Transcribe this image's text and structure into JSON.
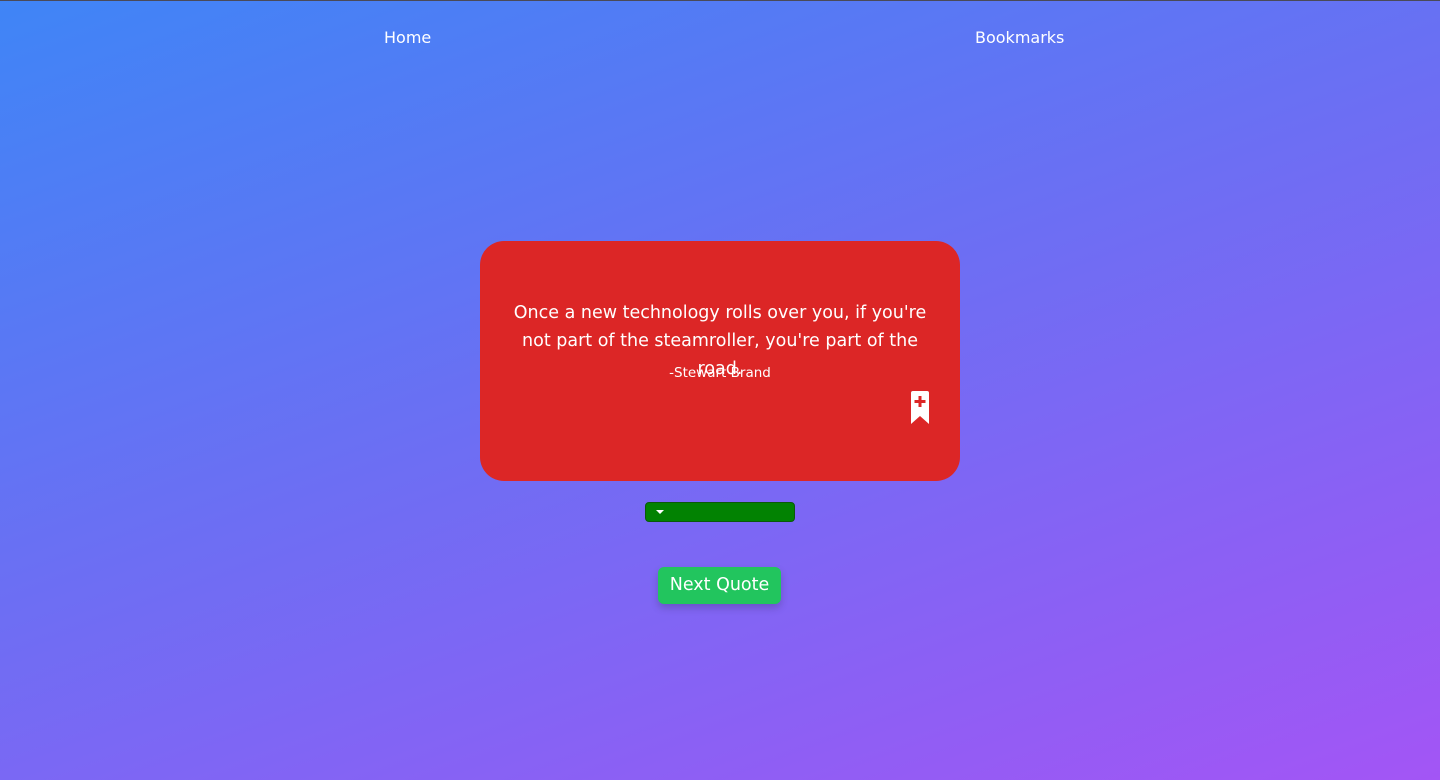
{
  "nav": {
    "home_label": "Home",
    "bookmarks_label": "Bookmarks"
  },
  "quote": {
    "text": "Once a new technology rolls over you, if you're not part of the steamroller, you're part of the road.",
    "author": "-Stewart Brand"
  },
  "bookmark_button": {
    "icon": "bookmark-plus-icon"
  },
  "category_select": {
    "selected": "",
    "icon": "chevron-down-icon"
  },
  "next_button": {
    "label": "Next Quote"
  },
  "colors": {
    "background_start": "#3f85f6",
    "background_end": "#a355f5",
    "card": "#dc2626",
    "select": "#028202",
    "next_button": "#22c55e",
    "text": "#ffffff"
  }
}
